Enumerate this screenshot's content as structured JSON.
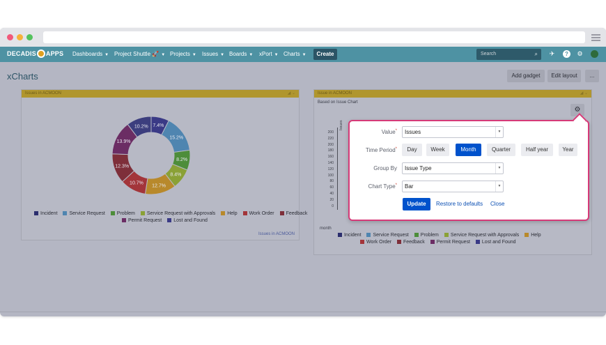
{
  "browser": {
    "dots": [
      "#f2597a",
      "#f6b13a",
      "#54c25d"
    ]
  },
  "navbar": {
    "logo_left": "DECADIS",
    "logo_right": "APPS",
    "items": [
      "Dashboards",
      "Project Shuttle 🚀",
      "Projects",
      "Issues",
      "Boards",
      "xPort",
      "Charts"
    ],
    "create_label": "Create",
    "search_placeholder": "Search",
    "icons": [
      "rocket-icon",
      "help-icon",
      "gear-icon",
      "avatar"
    ]
  },
  "page": {
    "title": "xCharts",
    "add_gadget": "Add gadget",
    "edit_layout": "Edit layout",
    "more": "..."
  },
  "gadget_left": {
    "header": "Issues in ACMOON",
    "footer_link": "Issues in ACMOON",
    "legend": [
      "Incident",
      "Service Request",
      "Problem",
      "Service Request with Approvals",
      "Help",
      "Work Order",
      "Feedback",
      "Permit Request",
      "Lost and Found"
    ]
  },
  "gadget_right": {
    "header": "Issue in ACMOON",
    "subheader": "Based on Issue Chart",
    "axis_label": "Issues",
    "xaxis_label": "month",
    "legend": [
      "Incident",
      "Service Request",
      "Problem",
      "Service Request with Approvals",
      "Help",
      "Work Order",
      "Feedback",
      "Permit Request",
      "Lost and Found"
    ]
  },
  "chart_data": {
    "type": "pie",
    "donut": true,
    "categories": [
      "Incident",
      "Service Request",
      "Problem",
      "Service Request with Approvals",
      "Help",
      "Work Order",
      "Feedback",
      "Permit Request",
      "Lost and Found"
    ],
    "slices": [
      {
        "name": "Lost and Found",
        "value": 7.4,
        "label": "7.4%",
        "color": "#3a3a86"
      },
      {
        "name": "Service Request",
        "value": 15.2,
        "label": "15.2%",
        "color": "#4f85b0"
      },
      {
        "name": "Problem",
        "value": 8.2,
        "label": "8.2%",
        "color": "#4d8d3a"
      },
      {
        "name": "Service Request with Approvals",
        "value": 8.4,
        "label": "8.4%",
        "color": "#8aa136"
      },
      {
        "name": "Help",
        "value": 12.7,
        "label": "12.7%",
        "color": "#b8892b"
      },
      {
        "name": "Work Order",
        "value": 10.7,
        "label": "10.7%",
        "color": "#a3353a"
      },
      {
        "name": "Feedback",
        "value": 12.3,
        "label": "12.3%",
        "color": "#7e2f3a"
      },
      {
        "name": "Permit Request",
        "value": 13.9,
        "label": "13.9%",
        "color": "#6b2d64"
      },
      {
        "name": "Incident",
        "value": 10.2,
        "label": "10.2%",
        "color": "#3c3e7e"
      }
    ],
    "bar_yticks": [
      "200",
      "220",
      "200",
      "180",
      "160",
      "140",
      "120",
      "100",
      "80",
      "60",
      "40",
      "20",
      "0"
    ]
  },
  "legend_colors": [
    "#2b2e6e",
    "#4f85b0",
    "#4d8d3a",
    "#8aa136",
    "#b8892b",
    "#a3353a",
    "#7e2f3a",
    "#6b2d64",
    "#3a3a86"
  ],
  "popup": {
    "value_label": "Value",
    "value_selected": "Issues",
    "time_period_label": "Time Period",
    "time_periods": [
      "Day",
      "Week",
      "Month",
      "Quarter",
      "Half year",
      "Year"
    ],
    "time_period_active": "Month",
    "group_by_label": "Group By",
    "group_by_selected": "Issue Type",
    "chart_type_label": "Chart Type",
    "chart_type_selected": "Bar",
    "update_label": "Update",
    "restore_label": "Restore to defaults",
    "close_label": "Close"
  }
}
